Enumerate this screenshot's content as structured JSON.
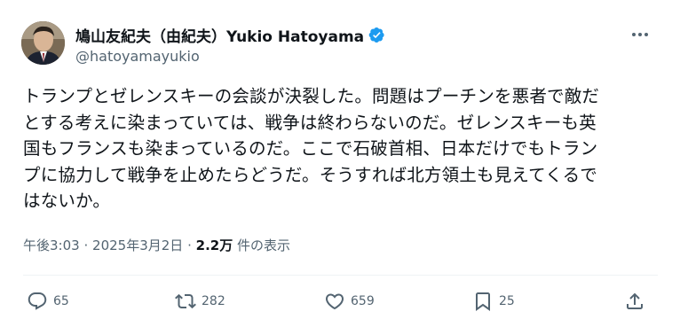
{
  "author": {
    "display_name": "鳩山友紀夫（由紀夫）Yukio Hatoyama",
    "handle": "@hatoyamayukio",
    "verified": true
  },
  "post": {
    "text": "トランプとゼレンスキーの会談が決裂した。問題はプーチンを悪者で敵だ\nとする考えに染まっていては、戦争は終わらないのだ。ゼレンスキーも英\n国もフランスも染まっているのだ。ここで石破首相、日本だけでもトラン\nプに協力して戦争を止めたらどうだ。そうすれば北方領土も見えてくるで\nはないか。",
    "time": "午後3:03",
    "separator": "·",
    "date": "2025年3月2日",
    "views_count": "2.2万",
    "views_label": "件の表示"
  },
  "actions": {
    "replies": "65",
    "reposts": "282",
    "likes": "659",
    "bookmarks": "25"
  },
  "colors": {
    "text": "#0f1419",
    "secondary": "#536471",
    "verified": "#1d9bf0",
    "divider": "#eff3f4"
  },
  "icons": [
    "avatar-photo",
    "verified-badge-icon",
    "more-icon",
    "reply-icon",
    "repost-icon",
    "like-icon",
    "bookmark-icon",
    "share-icon"
  ]
}
